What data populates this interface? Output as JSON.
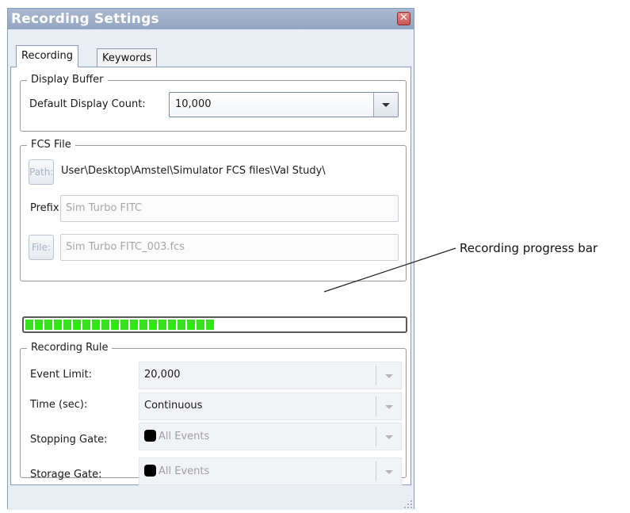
{
  "window": {
    "title": "Recording Settings",
    "close_glyph": "✕"
  },
  "tabs": [
    {
      "label": "Recording",
      "active": true
    },
    {
      "label": "Keywords",
      "active": false
    }
  ],
  "display_buffer": {
    "title": "Display Buffer",
    "default_display_count_label": "Default Display Count:",
    "default_display_count_value": "10,000"
  },
  "fcs_file": {
    "title": "FCS File",
    "path_button": "Path:",
    "path_value": "User\\Desktop\\Amstel\\Simulator FCS files\\Val Study\\",
    "prefix_label": "Prefix:",
    "prefix_value": "Sim Turbo FITC",
    "file_button": "File:",
    "file_value": "Sim Turbo FITC_003.fcs"
  },
  "progress": {
    "fraction": 0.5
  },
  "recording_rule": {
    "title": "Recording Rule",
    "event_limit_label": "Event Limit:",
    "event_limit_value": "20,000",
    "time_label": "Time (sec):",
    "time_value": "Continuous",
    "stopping_gate_label": "Stopping Gate:",
    "stopping_gate_value": "All Events",
    "storage_gate_label": "Storage Gate:",
    "storage_gate_value": "All Events"
  },
  "annotation": {
    "label": "Recording progress bar"
  },
  "colors": {
    "progress_fill": "#39e21f",
    "titlebar": "#9fb0c9",
    "gate_color": "#000000"
  }
}
